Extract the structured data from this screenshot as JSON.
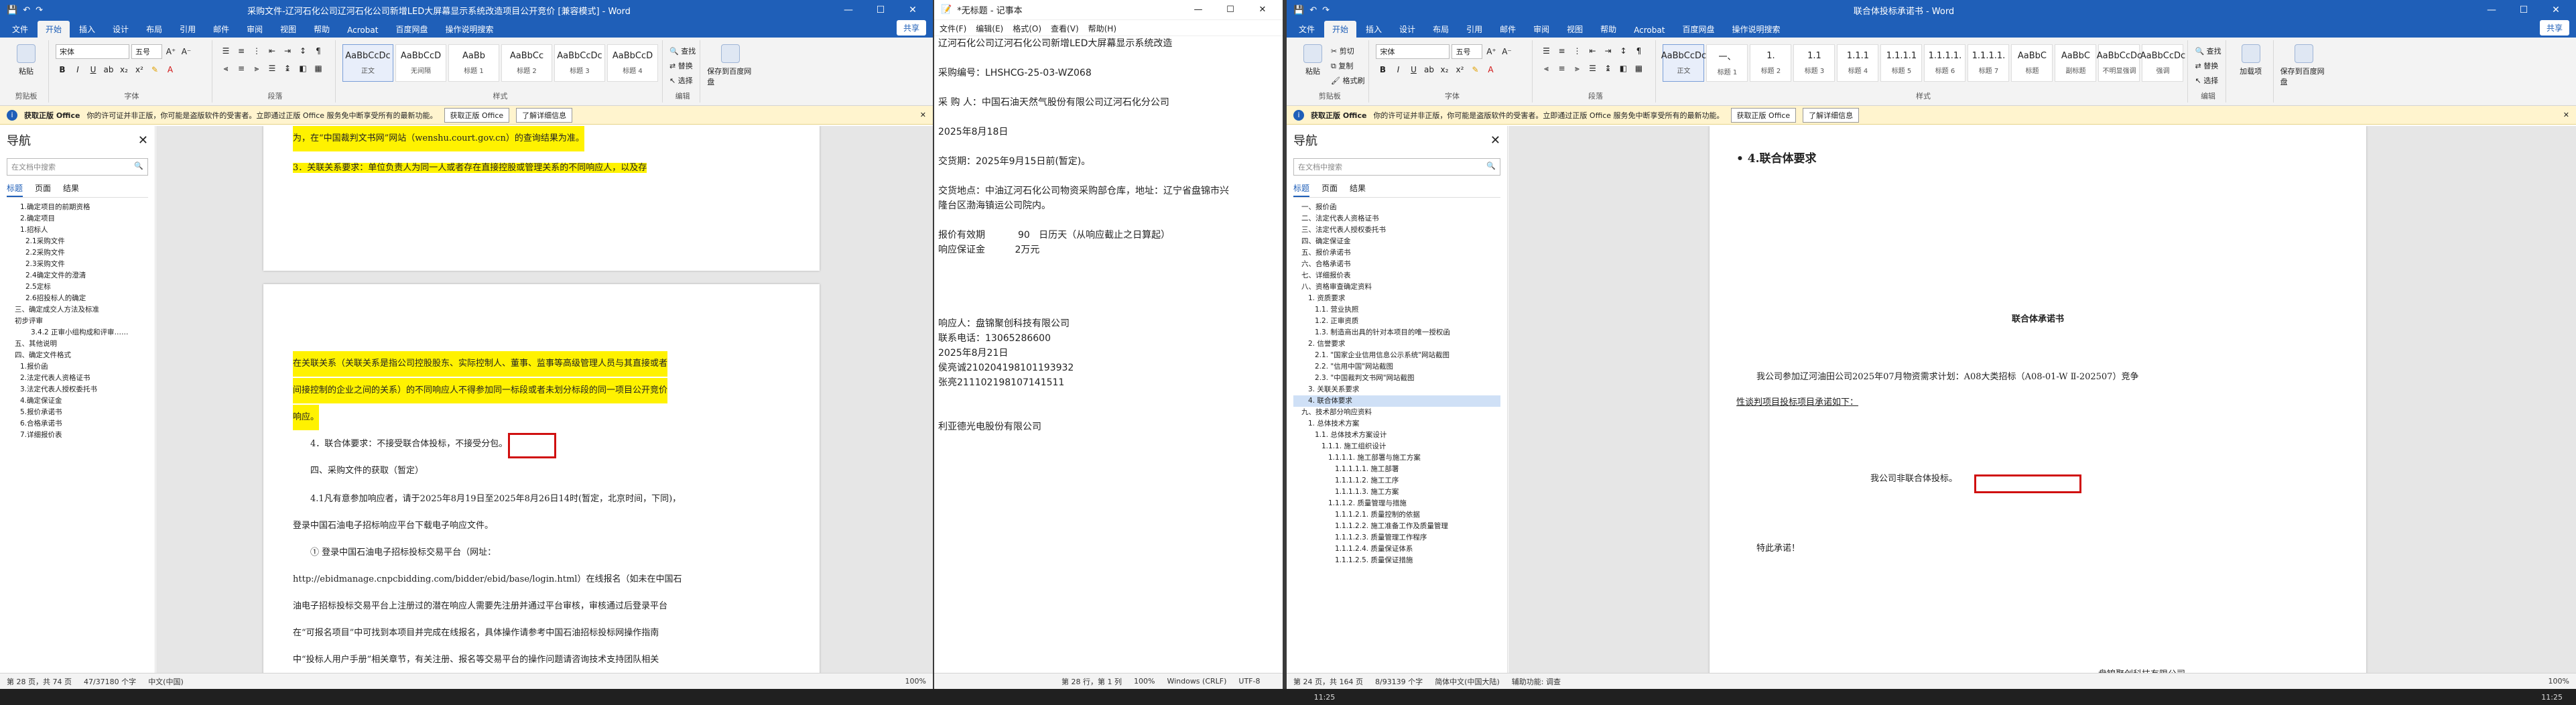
{
  "w1": {
    "title": "采购文件-辽河石化公司辽河石化公司新增LED大屏幕显示系统改造项目公开竞价 [兼容模式] - Word",
    "tabs": [
      "文件",
      "开始",
      "插入",
      "设计",
      "布局",
      "引用",
      "邮件",
      "审阅",
      "视图",
      "帮助",
      "Acrobat",
      "百度网盘",
      "操作说明搜索"
    ],
    "share": "共享",
    "ribbon": {
      "paste": "粘贴",
      "clipboard": "剪贴板",
      "font_name": "宋体",
      "font_size": "五号",
      "font_group": "字体",
      "para_group": "段落",
      "styles": [
        {
          "preview": "AaBbCcDc",
          "name": "正文"
        },
        {
          "preview": "AaBbCcD",
          "name": "无间隔"
        },
        {
          "preview": "AaBb",
          "name": "标题 1"
        },
        {
          "preview": "AaBbCc",
          "name": "标题 2"
        },
        {
          "preview": "AaBbCcDc",
          "name": "标题 3"
        },
        {
          "preview": "AaBbCcD",
          "name": "标题 4"
        }
      ],
      "styles_group": "样式",
      "find": "查找",
      "replace": "替换",
      "select": "选择",
      "edit_group": "编辑",
      "save_baidu": "保存到百度网盘"
    },
    "info": {
      "label": "获取正版 Office",
      "text": "你的许可证并非正版，你可能是盗版软件的受害者。立即通过正版 Office 服务免中断享受所有的最新功能。",
      "btn1": "获取正版 Office",
      "btn2": "了解详细信息"
    },
    "nav": {
      "title": "导航",
      "search": "在文档中搜索",
      "tabs": [
        "标题",
        "页面",
        "结果"
      ],
      "items": [
        "1.确定项目的前期资格",
        "2.确定项目",
        "1.招标人",
        "2.1采购文件",
        "2.2采购文件",
        "2.3采购文件",
        "2.4确定文件的澄清",
        "2.5定标",
        "2.6招投标人的确定",
        "三、确定成交人方法及标准",
        "初步评审",
        "3.4.2 正审小组构成和评审……",
        "五、其他说明",
        "四、确定文件格式",
        "1.报价函",
        "2.法定代表人资格证书",
        "3.法定代表人授权委托书",
        "4.确定保证金",
        "5.报价承诺书",
        "6.合格承诺书",
        "7.详细报价表"
      ]
    },
    "paras": [
      "为，在“中国裁判文书网”网站（wenshu.court.gov.cn）的查询结果为准。",
      "3．关联关系要求：单位负责人为同一人或者存在直接控股或管理关系的不同响应人，以及存",
      "在关联关系（关联关系是指公司控股股东、实际控制人、董事、监事等高级管理人员与其直接或者",
      "间接控制的企业之间的关系）的不同响应人不得参加同一标段或者未划分标段的同一项目公开竞价",
      "响应。",
      "4．联合体要求：不接受联合体投标，不接受分包。",
      "四、采购文件的获取（暂定）",
      "4.1凡有意参加响应者，请于2025年8月19日至2025年8月26日14时(暂定，北京时间，下同)，",
      "登录中国石油电子招标响应平台下载电子响应文件。",
      "① 登录中国石油电子招标投标交易平台（网址：",
      "http://ebidmanage.cnpcbidding.com/bidder/ebid/base/login.html）在线报名（如未在中国石",
      "油电子招标投标交易平台上注册过的潜在响应人需要先注册并通过平台审核，审核通过后登录平台",
      "在“可报名项目”中可找到本项目并完成在线报名，具体操作请参考中国石油招标投标网操作指南",
      "中“投标人用户手册”相关章节，有关注册、报名等交易平台的操作问题请咨询技术支持团队相关"
    ],
    "status": {
      "page": "第 28 页，共 74 页",
      "words": "47/37180 个字",
      "lang": "中文(中国)",
      "zoom": "100%"
    }
  },
  "w2": {
    "title": "*无标题 - 记事本",
    "menu": [
      "文件(F)",
      "编辑(E)",
      "格式(O)",
      "查看(V)",
      "帮助(H)"
    ],
    "lines": [
      "辽河石化公司辽河石化公司新增LED大屏幕显示系统改造",
      "",
      "采购编号：LHSHCG-25-03-WZ068",
      "",
      "采 购 人：中国石油天然气股份有限公司辽河石化分公司",
      "",
      "2025年8月18日",
      "",
      "交货期：2025年9月15日前(暂定)。",
      "",
      "交货地点：中油辽河石化公司物资采购部仓库，地址：辽宁省盘锦市兴",
      "隆台区渤海镇运公司院内。",
      "",
      "报价有效期           90   日历天（从响应截止之日算起）",
      "响应保证金          2万元",
      "",
      "",
      "",
      "",
      "响应人：盘锦聚创科技有限公司",
      "联系电话：13065286600",
      "2025年8月21日",
      "侯亮诚210204198101193932",
      "张亮211102198107141511",
      "",
      "",
      "利亚德光电股份有限公司"
    ],
    "status": {
      "pos": "第 28 行，第 1 列",
      "zoom": "100%",
      "eol": "Windows (CRLF)",
      "enc": "UTF-8"
    }
  },
  "w3": {
    "title": "联合体投标承诺书 - Word",
    "tabs": [
      "文件",
      "开始",
      "插入",
      "设计",
      "布局",
      "引用",
      "邮件",
      "审阅",
      "视图",
      "帮助",
      "Acrobat",
      "百度网盘",
      "操作说明搜索"
    ],
    "share": "共享",
    "ribbon": {
      "paste": "粘贴",
      "cut": "剪切",
      "copy": "复制",
      "format_painter": "格式刷",
      "clipboard": "剪贴板",
      "font_name": "宋体",
      "font_size": "五号",
      "font_group": "字体",
      "para_group": "段落",
      "styles": [
        {
          "preview": "AaBbCcDc",
          "name": "正文"
        },
        {
          "preview": "一、",
          "name": "标题 1"
        },
        {
          "preview": "1.",
          "name": "标题 2"
        },
        {
          "preview": "1.1",
          "name": "标题 3"
        },
        {
          "preview": "1.1.1",
          "name": "标题 4"
        },
        {
          "preview": "1.1.1.1",
          "name": "标题 5"
        },
        {
          "preview": "1.1.1.1.",
          "name": "标题 6"
        },
        {
          "preview": "1.1.1.1.",
          "name": "标题 7"
        },
        {
          "preview": "AaBbC",
          "name": "标题"
        },
        {
          "preview": "AaBbC",
          "name": "副标题"
        },
        {
          "preview": "AaBbCcDc",
          "name": "不明显强调"
        },
        {
          "preview": "AaBbCcDc",
          "name": "强调"
        }
      ],
      "styles_group": "样式",
      "find": "查找",
      "replace": "替换",
      "select": "选择",
      "edit_group": "编辑",
      "pdf": "加载项",
      "save_baidu": "保存到百度网盘"
    },
    "info": {
      "label": "获取正版 Office",
      "text": "你的许可证并非正版，你可能是盗版软件的受害者。立即通过正版 Office 服务免中断享受所有的最新功能。",
      "btn1": "获取正版 Office",
      "btn2": "了解详细信息"
    },
    "nav": {
      "title": "导航",
      "search": "在文档中搜索",
      "tabs": [
        "标题",
        "页面",
        "结果"
      ],
      "items": [
        "一、报价函",
        "二、法定代表人资格证书",
        "三、法定代表人授权委托书",
        "四、确定保证金",
        "五、报价承诺书",
        "六、合格承诺书",
        "七、详细报价表",
        "八、资格审查确定资料",
        "1. 资质要求",
        "1.1. 营业执照",
        "1.2. 正审资质",
        "1.3. 制造商出具的针对本项目的唯一授权函",
        "2. 信誉要求",
        "2.1. \"国家企业信用信息公示系统\"网站截图",
        "2.2. \"信用中国\"网站截图",
        "2.3. \"中国裁判文书网\"网站截图",
        "3. 关联关系要求",
        "4. 联合体要求",
        "九、技术部分响应资料",
        "1. 总体技术方案",
        "1.1. 总体技术方案设计",
        "1.1.1. 施工组织设计",
        "1.1.1.1. 施工部署与施工方案",
        "1.1.1.1.1. 施工部署",
        "1.1.1.1.2. 施工工序",
        "1.1.1.1.3. 施工方案",
        "1.1.1.2. 质量管理与措施",
        "1.1.1.2.1. 质量控制的依据",
        "1.1.1.2.2. 施工准备工作及质量管理",
        "1.1.1.2.3. 质量管理工作程序",
        "1.1.1.2.4. 质量保证体系",
        "1.1.1.2.5. 质量保证措施"
      ],
      "selected": 17
    },
    "paras": {
      "heading": "4.联合体要求",
      "doc_title": "联合体承诺书",
      "line1": "我公司参加辽河油田公司2025年07月物资需求计划：A08大类招标（A08-01-W Ⅱ-202507）竞争",
      "line2": "性谈判项目投标项目承诺如下：",
      "line3": "我公司非联合体投标。",
      "line4": "特此承诺！",
      "sign": "盘锦聚创科技有限公司"
    },
    "status": {
      "page": "第 24 页，共 164 页",
      "words": "8/93139 个字",
      "lang": "简体中文(中国大陆)",
      "access": "辅助功能: 调查",
      "zoom": "100%"
    }
  },
  "taskbar": {
    "clock1": "11:25",
    "clock2": "11:25"
  },
  "colors": {
    "word_blue": "#1f5fb8",
    "highlight": "#fff200",
    "red_box": "#d01010",
    "info_bar": "#fff4ce"
  }
}
